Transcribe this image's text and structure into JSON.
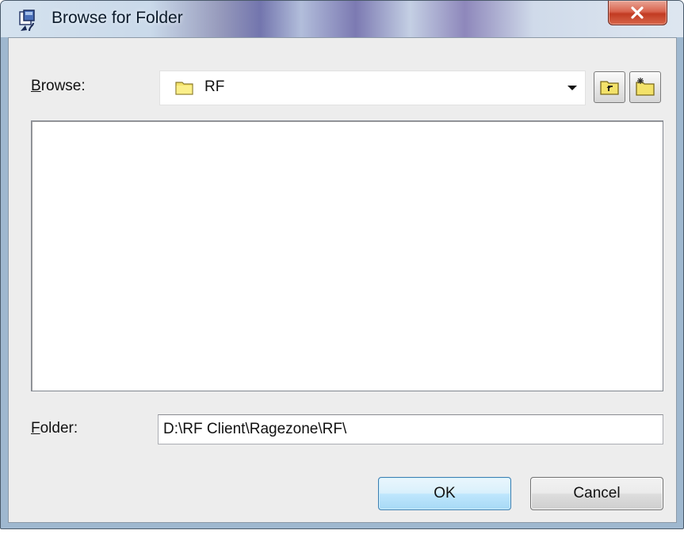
{
  "window": {
    "title": "Browse for Folder",
    "title_icon": "browse-folder-app-icon",
    "close_icon": "close-x-icon",
    "accent_close": "#c9432a"
  },
  "browse": {
    "label_accel": "B",
    "label_rest": "rowse:",
    "selected": "RF",
    "folder_icon": "folder-icon",
    "dropdown_icon": "chevron-down-icon",
    "up_button_icon": "up-one-level-icon",
    "new_folder_button_icon": "new-folder-icon"
  },
  "folder_tree": {
    "items": []
  },
  "folder": {
    "label_accel": "F",
    "label_rest": "older:",
    "value": "D:\\RF Client\\Ragezone\\RF\\"
  },
  "buttons": {
    "ok": "OK",
    "cancel": "Cancel"
  }
}
